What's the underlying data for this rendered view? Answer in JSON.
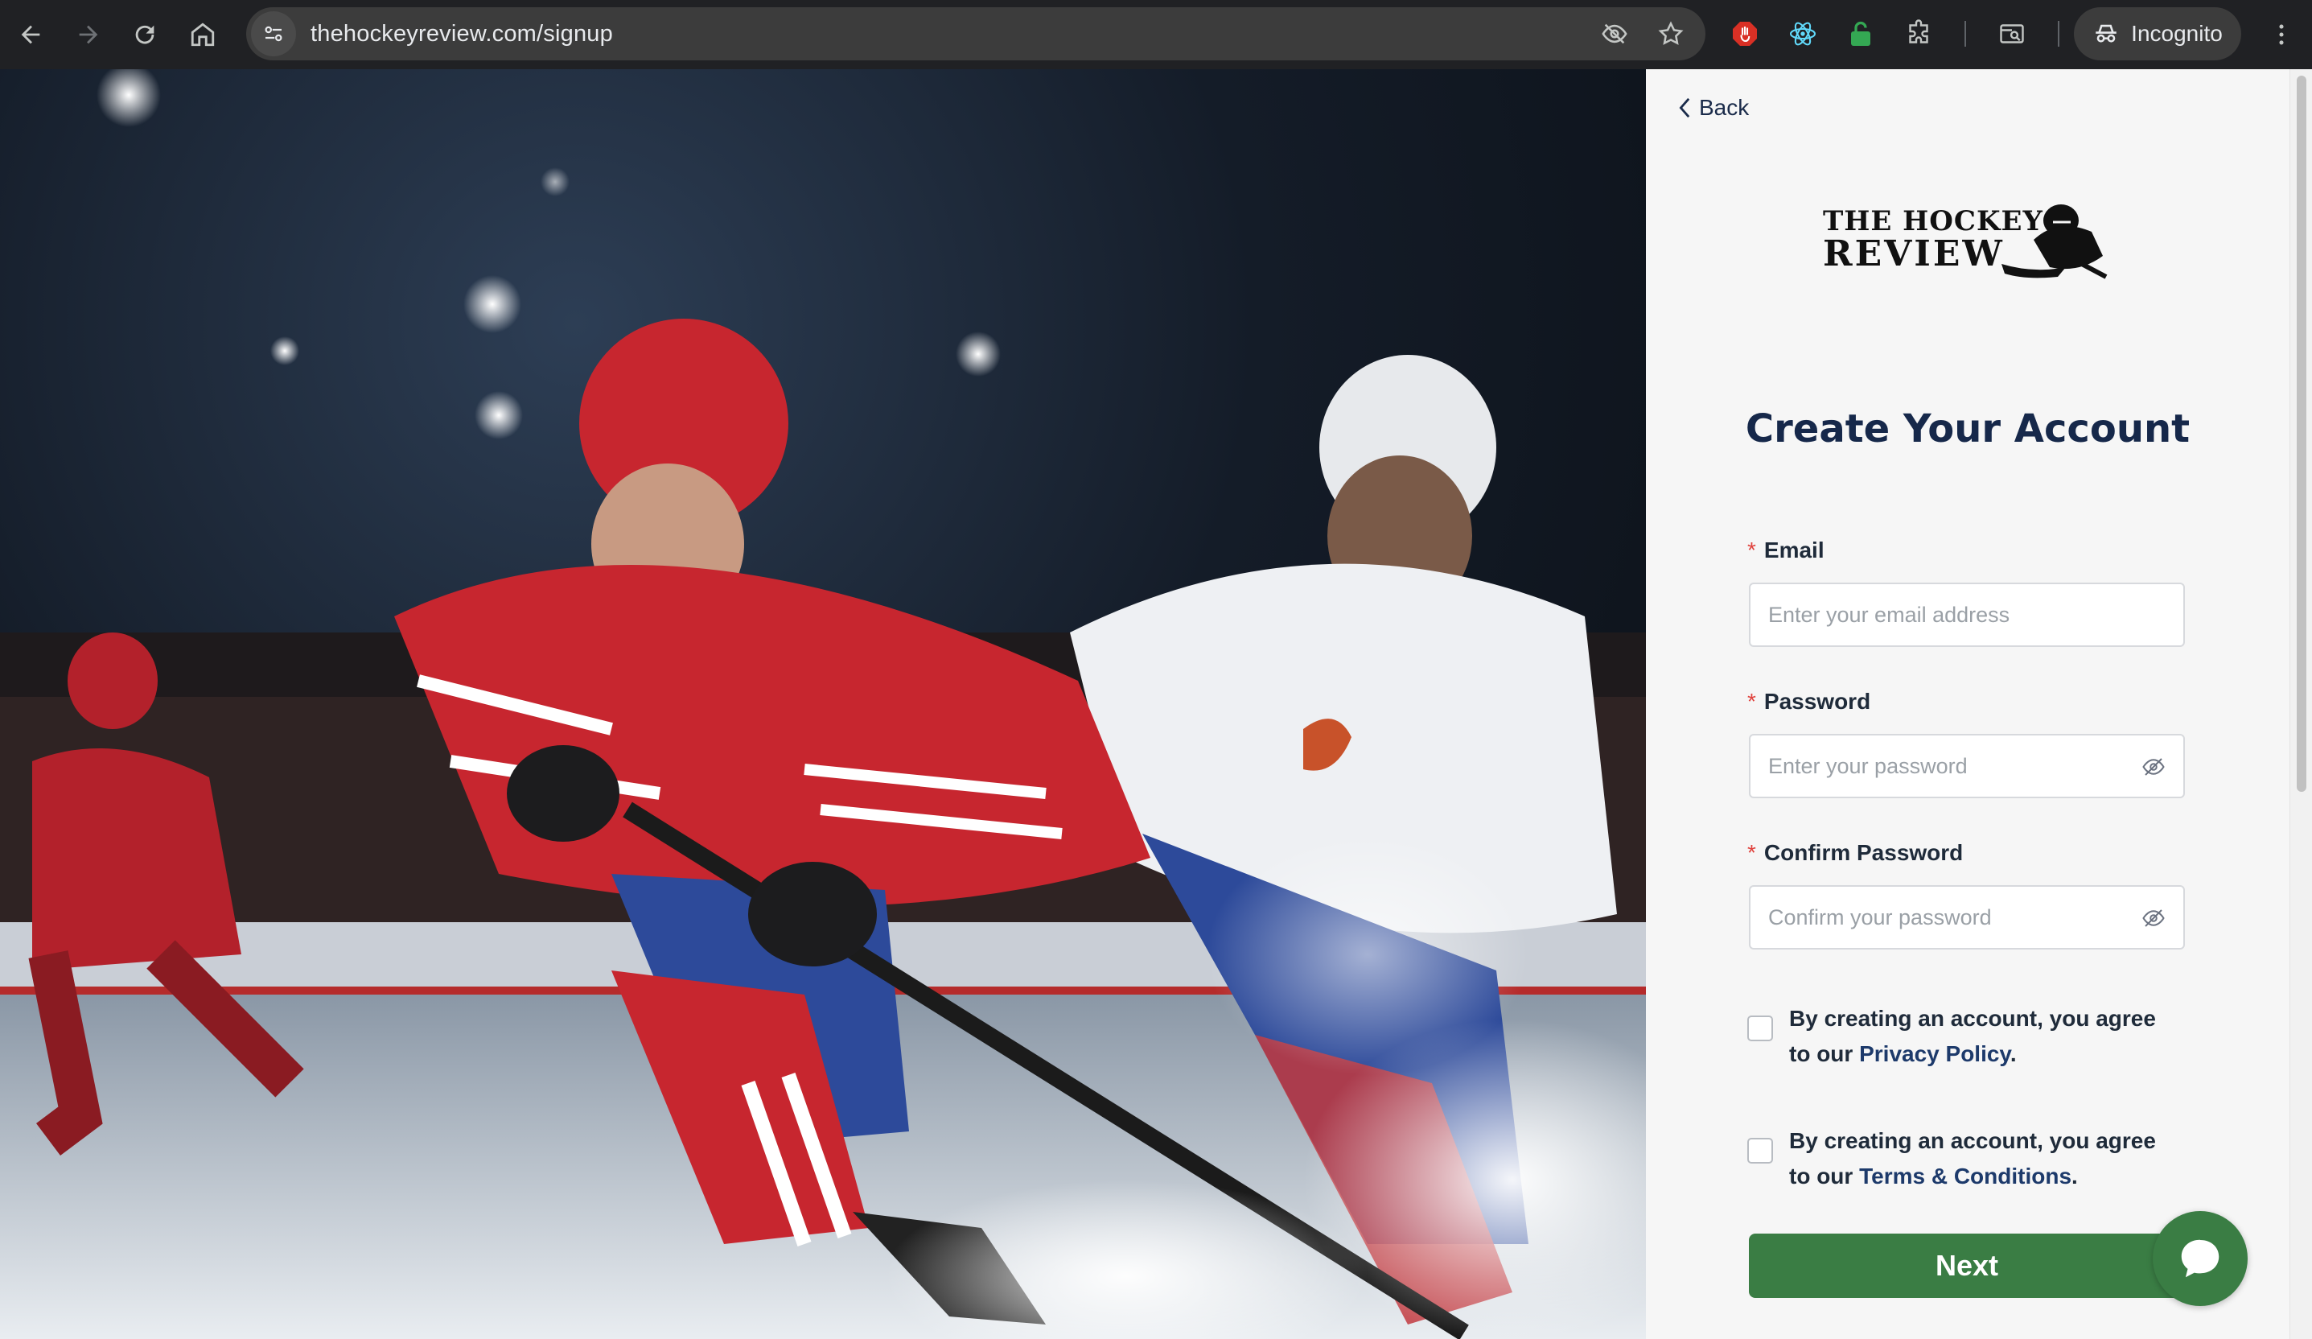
{
  "browser": {
    "url": "thehockeyreview.com/signup",
    "incognito_label": "Incognito"
  },
  "panel": {
    "back_label": "Back",
    "logo": {
      "line1": "THE HOCKEY",
      "line2": "REVIEW"
    },
    "title": "Create Your Account",
    "fields": {
      "email": {
        "required_mark": "*",
        "label": "Email",
        "placeholder": "Enter your email address"
      },
      "password": {
        "required_mark": "*",
        "label": "Password",
        "placeholder": "Enter your password"
      },
      "confirm_password": {
        "required_mark": "*",
        "label": "Confirm Password",
        "placeholder": "Confirm your password"
      }
    },
    "consents": {
      "privacy": {
        "prefix": "By creating an account, you agree to our ",
        "link": "Privacy Policy",
        "suffix": "."
      },
      "terms": {
        "prefix": "By creating an account, you agree to our ",
        "link": "Terms & Conditions",
        "suffix": "."
      }
    },
    "next_label": "Next"
  },
  "colors": {
    "accent_green": "#3a7d44",
    "title_navy": "#16284a",
    "required_red": "#e0423d"
  },
  "icons": [
    "back-arrow-icon",
    "forward-arrow-icon",
    "reload-icon",
    "home-icon",
    "site-info-icon",
    "eye-off-icon",
    "star-icon",
    "extension-icon",
    "incognito-icon",
    "menu-icon",
    "chevron-left-icon",
    "chat-icon"
  ]
}
